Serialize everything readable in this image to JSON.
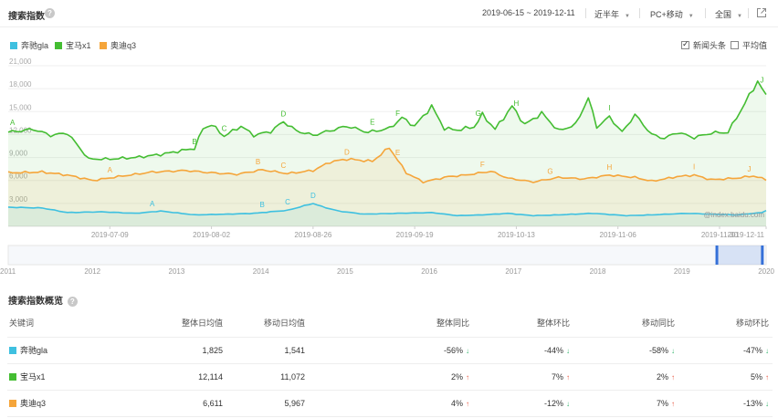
{
  "header": {
    "title": "搜索指数",
    "date_range": "2019-06-15 ~ 2019-12-11",
    "period": "近半年",
    "device": "PC+移动",
    "region": "全国"
  },
  "legend": [
    {
      "name": "奔驰gla",
      "color": "#3ec0e0"
    },
    {
      "name": "宝马x1",
      "color": "#44bd32"
    },
    {
      "name": "奥迪q3",
      "color": "#f5a53a"
    }
  ],
  "options": {
    "news_label": "新闻头条",
    "news_checked": true,
    "avg_label": "平均值",
    "avg_checked": false
  },
  "chart_data": {
    "type": "area",
    "x_ticks": [
      "2019-07-09",
      "2019-08-02",
      "2019-08-26",
      "2019-09-19",
      "2019-10-13",
      "2019-11-06",
      "2019-11-30",
      "2019-12-11"
    ],
    "y_ticks": [
      "3,000",
      "6,000",
      "9,000",
      "12,000",
      "15,000",
      "18,000",
      "21,000"
    ],
    "ylim": [
      0,
      21000
    ],
    "x_count": 180,
    "series": [
      {
        "name": "宝马x1",
        "color": "#44bd32",
        "points": [
          [
            0,
            12300
          ],
          [
            6,
            12700
          ],
          [
            10,
            11900
          ],
          [
            14,
            12200
          ],
          [
            19,
            8800
          ],
          [
            24,
            8800
          ],
          [
            30,
            9000
          ],
          [
            36,
            9400
          ],
          [
            44,
            10200
          ],
          [
            46,
            12800
          ],
          [
            48,
            13300
          ],
          [
            51,
            11800
          ],
          [
            55,
            13100
          ],
          [
            58,
            11900
          ],
          [
            62,
            12400
          ],
          [
            65,
            13700
          ],
          [
            68,
            12500
          ],
          [
            72,
            11900
          ],
          [
            80,
            13100
          ],
          [
            85,
            12300
          ],
          [
            90,
            12800
          ],
          [
            93,
            14200
          ],
          [
            96,
            13100
          ],
          [
            100,
            15700
          ],
          [
            103,
            12800
          ],
          [
            106,
            12600
          ],
          [
            110,
            13000
          ],
          [
            112,
            14600
          ],
          [
            115,
            12700
          ],
          [
            119,
            15700
          ],
          [
            122,
            13300
          ],
          [
            126,
            14800
          ],
          [
            130,
            12500
          ],
          [
            134,
            13300
          ],
          [
            137,
            16800
          ],
          [
            139,
            13000
          ],
          [
            142,
            14300
          ],
          [
            145,
            12300
          ],
          [
            148,
            14600
          ],
          [
            152,
            12000
          ],
          [
            155,
            11500
          ],
          [
            158,
            12300
          ],
          [
            162,
            11600
          ],
          [
            166,
            12200
          ],
          [
            170,
            12300
          ],
          [
            174,
            16100
          ],
          [
            177,
            19000
          ],
          [
            179,
            17000
          ]
        ],
        "annotations": [
          {
            "label": "A",
            "i": 1
          },
          {
            "label": "B",
            "i": 44
          },
          {
            "label": "C",
            "i": 51
          },
          {
            "label": "D",
            "i": 65
          },
          {
            "label": "E",
            "i": 86
          },
          {
            "label": "F",
            "i": 92
          },
          {
            "label": "G",
            "i": 111
          },
          {
            "label": "H",
            "i": 120
          },
          {
            "label": "I",
            "i": 142
          },
          {
            "label": "J",
            "i": 178
          }
        ]
      },
      {
        "name": "奥迪q3",
        "color": "#f5a53a",
        "points": [
          [
            0,
            7000
          ],
          [
            8,
            7100
          ],
          [
            14,
            6700
          ],
          [
            20,
            6000
          ],
          [
            26,
            6500
          ],
          [
            34,
            7100
          ],
          [
            42,
            7300
          ],
          [
            48,
            7000
          ],
          [
            54,
            6800
          ],
          [
            60,
            7400
          ],
          [
            66,
            6900
          ],
          [
            72,
            7300
          ],
          [
            76,
            8400
          ],
          [
            80,
            8800
          ],
          [
            86,
            8500
          ],
          [
            90,
            10300
          ],
          [
            94,
            7000
          ],
          [
            98,
            5800
          ],
          [
            104,
            6500
          ],
          [
            108,
            6700
          ],
          [
            114,
            7200
          ],
          [
            118,
            6300
          ],
          [
            124,
            5800
          ],
          [
            130,
            6400
          ],
          [
            136,
            6200
          ],
          [
            142,
            6700
          ],
          [
            148,
            6400
          ],
          [
            152,
            5900
          ],
          [
            158,
            6500
          ],
          [
            162,
            6700
          ],
          [
            166,
            6100
          ],
          [
            172,
            6300
          ],
          [
            176,
            6600
          ],
          [
            179,
            6100
          ]
        ],
        "annotations": [
          {
            "label": "A",
            "i": 24
          },
          {
            "label": "B",
            "i": 59
          },
          {
            "label": "C",
            "i": 65
          },
          {
            "label": "D",
            "i": 80
          },
          {
            "label": "E",
            "i": 92
          },
          {
            "label": "F",
            "i": 112
          },
          {
            "label": "G",
            "i": 128
          },
          {
            "label": "H",
            "i": 142
          },
          {
            "label": "I",
            "i": 162
          },
          {
            "label": "J",
            "i": 175
          }
        ]
      },
      {
        "name": "奔驰gla",
        "color": "#3ec0e0",
        "points": [
          [
            0,
            2500
          ],
          [
            8,
            2400
          ],
          [
            14,
            1800
          ],
          [
            22,
            1900
          ],
          [
            30,
            1700
          ],
          [
            36,
            2000
          ],
          [
            44,
            1500
          ],
          [
            52,
            1600
          ],
          [
            58,
            1700
          ],
          [
            62,
            1900
          ],
          [
            66,
            2100
          ],
          [
            70,
            2700
          ],
          [
            72,
            3000
          ],
          [
            74,
            2600
          ],
          [
            78,
            2000
          ],
          [
            84,
            1600
          ],
          [
            92,
            1700
          ],
          [
            100,
            1800
          ],
          [
            106,
            1400
          ],
          [
            112,
            1500
          ],
          [
            118,
            1700
          ],
          [
            124,
            1400
          ],
          [
            130,
            1500
          ],
          [
            138,
            1700
          ],
          [
            146,
            1400
          ],
          [
            152,
            1500
          ],
          [
            160,
            1700
          ],
          [
            166,
            1600
          ],
          [
            172,
            1500
          ],
          [
            176,
            1700
          ],
          [
            178,
            1800
          ],
          [
            179,
            2100
          ]
        ],
        "annotations": [
          {
            "label": "A",
            "i": 34
          },
          {
            "label": "B",
            "i": 60
          },
          {
            "label": "C",
            "i": 66
          },
          {
            "label": "D",
            "i": 72
          }
        ]
      }
    ],
    "watermark": "@index.baidu.com"
  },
  "overview_axis": {
    "years": [
      "2011",
      "2012",
      "2013",
      "2014",
      "2015",
      "2016",
      "2017",
      "2018",
      "2019",
      "2020"
    ],
    "selection_start": 0.935,
    "selection_end": 0.995
  },
  "overview": {
    "title": "搜索指数概览",
    "headers": [
      "关键词",
      "整体日均值",
      "移动日均值",
      "整体同比",
      "整体环比",
      "移动同比",
      "移动环比"
    ],
    "rows": [
      {
        "name": "奔驰gla",
        "color": "#3ec0e0",
        "total_avg": "1,825",
        "mobile_avg": "1,541",
        "total_yoy": "-56%",
        "total_yoy_dir": "down",
        "total_mom": "-44%",
        "total_mom_dir": "down",
        "mobile_yoy": "-58%",
        "mobile_yoy_dir": "down",
        "mobile_mom": "-47%",
        "mobile_mom_dir": "down"
      },
      {
        "name": "宝马x1",
        "color": "#44bd32",
        "total_avg": "12,114",
        "mobile_avg": "11,072",
        "total_yoy": "2%",
        "total_yoy_dir": "up",
        "total_mom": "7%",
        "total_mom_dir": "up",
        "mobile_yoy": "2%",
        "mobile_yoy_dir": "up",
        "mobile_mom": "5%",
        "mobile_mom_dir": "up"
      },
      {
        "name": "奥迪q3",
        "color": "#f5a53a",
        "total_avg": "6,611",
        "mobile_avg": "5,967",
        "total_yoy": "4%",
        "total_yoy_dir": "up",
        "total_mom": "-12%",
        "total_mom_dir": "down",
        "mobile_yoy": "7%",
        "mobile_yoy_dir": "up",
        "mobile_mom": "-13%",
        "mobile_mom_dir": "down"
      }
    ]
  }
}
